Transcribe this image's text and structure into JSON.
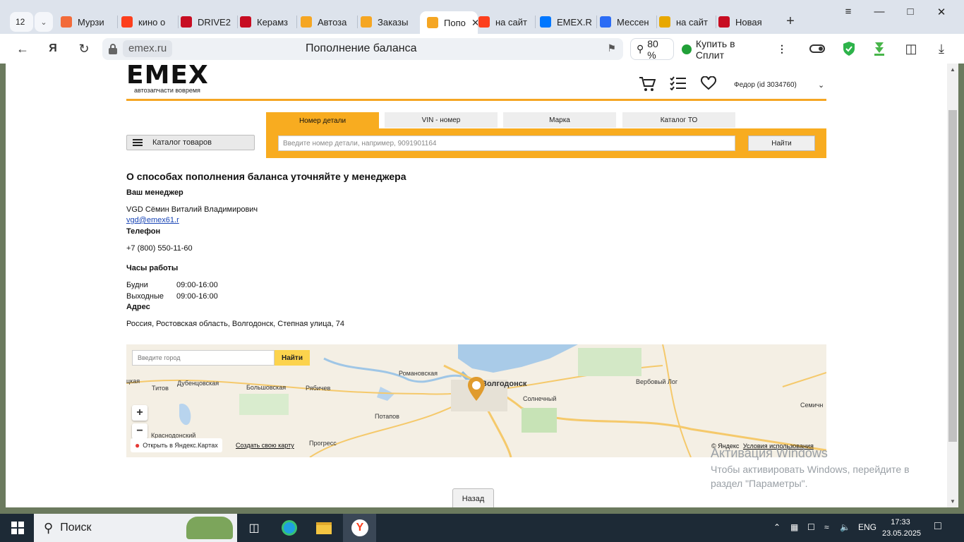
{
  "browser": {
    "tab_count": "12",
    "tabs": [
      {
        "label": "Мурзи",
        "icon": "hotel-icon",
        "color": "#f26b3a"
      },
      {
        "label": "кино о",
        "icon": "yandex-icon",
        "color": "#fc3f1d"
      },
      {
        "label": "DRIVE2",
        "icon": "drive2-icon",
        "color": "#c70d22"
      },
      {
        "label": "Керамз",
        "icon": "drive2-icon",
        "color": "#c70d22"
      },
      {
        "label": "Автоза",
        "icon": "emex-icon",
        "color": "#f5a623"
      },
      {
        "label": "Заказы",
        "icon": "emex-icon",
        "color": "#f5a623"
      },
      {
        "label": "Попо",
        "icon": "emex-icon",
        "color": "#f5a623"
      },
      {
        "label": "на сайт",
        "icon": "yandex-icon",
        "color": "#fc3f1d"
      },
      {
        "label": "EMEX.R",
        "icon": "vk-icon",
        "color": "#0077ff"
      },
      {
        "label": "Мессен",
        "icon": "messenger-icon",
        "color": "#2b6cf5"
      },
      {
        "label": "на сайт",
        "icon": "image-icon",
        "color": "#e8a800"
      },
      {
        "label": "Новая",
        "icon": "drive2-icon",
        "color": "#c70d22"
      }
    ],
    "domain": "emex.ru",
    "page_title": "Пополнение баланса",
    "zoom": "80 %",
    "split_label": "Купить в Сплит"
  },
  "header": {
    "logo_text": "EMEX",
    "logo_tagline": "автозапчасти вовремя",
    "user": "Федор  (id 3034760)"
  },
  "search": {
    "tabs": [
      "Номер детали",
      "VIN - номер",
      "Марка",
      "Каталог ТО"
    ],
    "placeholder": "Введите номер детали, например, 9091901164",
    "button": "Найти",
    "catalog_button": "Каталог товаров"
  },
  "content": {
    "heading": "О способах пополнения баланса уточняйте у менеджера",
    "manager_label": "Ваш менеджер",
    "manager_name": "VGD Сёмин Виталий Владимирович",
    "manager_email": "vgd@emex61.r",
    "phone_label": "Телефон",
    "phone": "+7 (800) 550-11-60",
    "hours_label": "Часы работы",
    "weekdays_label": "Будни",
    "weekdays_hours": "09:00-16:00",
    "weekend_label": "Выходные",
    "weekend_hours": "09:00-16:00",
    "address_label": "Адрес",
    "address": "Россия, Ростовская область, Волгодонск, Степная улица, 74",
    "back_button": "Назад"
  },
  "map": {
    "city_placeholder": "Введите город",
    "find_button": "Найти",
    "open_in_yandex": "Открыть в Яндекс.Картах",
    "create_map": "Создать свою карту",
    "copyright": "© Яндекс",
    "terms": "Условия использования",
    "places": [
      "Романовская",
      "Волгодонск",
      "Вербовый Лог",
      "Дубенцовская",
      "Большовская",
      "Рябичев",
      "Титов",
      "Солнечный",
      "Потапов",
      "Семичн",
      "Краснодонский",
      "Прогресс",
      "цкая"
    ]
  },
  "watermark": {
    "title": "Активация Windows",
    "line1": "Чтобы активировать Windows, перейдите в",
    "line2": "раздел \"Параметры\"."
  },
  "taskbar": {
    "search_label": "Поиск",
    "lang": "ENG",
    "time": "17:33",
    "date": "23.05.2025"
  }
}
